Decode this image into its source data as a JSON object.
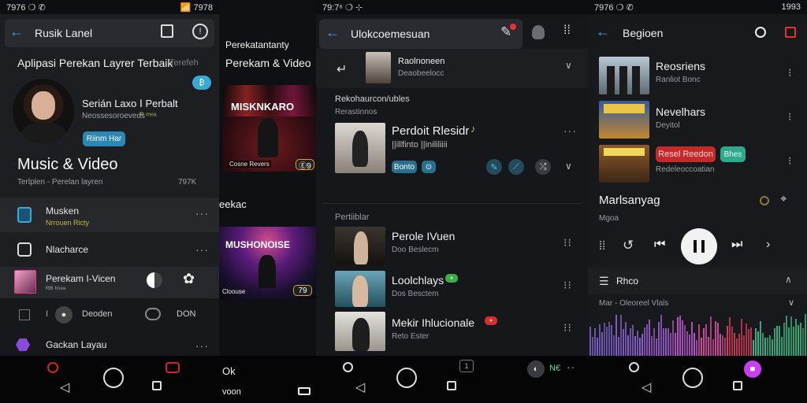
{
  "p1": {
    "status_left": "7976 ❍ ✆",
    "status_right": "📶 7978",
    "header_title": "Rusik Lanel",
    "title": "Aplipasi Perekan Layrer Terbaik",
    "title_tag": "Terefeh",
    "badge": "₿",
    "profile_name": "Serián Laxo Ⅰ Perbalt",
    "profile_sub1": "Neossesoroeveds",
    "profile_sub2": "ᴿ ᵐᵉᵃ",
    "profile_button": "Riinm Har",
    "section_title": "Music & Video",
    "section_sub": "Terlplen - Perelan layren",
    "section_count": "797K",
    "items": [
      {
        "label": "Musken",
        "sub": "Nrrouen Ricty"
      },
      {
        "label": "Nlacharce",
        "sub": ""
      },
      {
        "label": "Perekam I-Vicen",
        "sub": "ᴿᴵᴮ ᴵᵐᵉᵃ"
      },
      {
        "label": "Deoden",
        "sub": "",
        "pre": "I",
        "right": "DON"
      },
      {
        "label": "Gackan Layau",
        "sub": ""
      }
    ]
  },
  "p2": {
    "head1": "Perekatantanty",
    "head2": "Perekam & Video",
    "thumb1_title": "MISKNKARO",
    "thumb1_caption": "Cosne Revers",
    "thumb1_badge": "Ⓔ9",
    "section": "eekac",
    "thumb2_title": "MUSHONOISE",
    "thumb2_caption": "Cloouse",
    "thumb2_badge": "79",
    "nav_label1": "Ok",
    "nav_label2": "voon"
  },
  "p3": {
    "status_left": "79:7⁶ ❍ ⊹",
    "search_text": "Ulokcoemesuan",
    "top_item_title": "Raolnoneen",
    "top_item_sub": "Deaobeelocc",
    "section1": "Rekohaurcon/ubles",
    "section1_sub": "Rerastinnos",
    "card_title": "Perdoit Rlesidr",
    "card_sub": "||illfinto ||inililiiii",
    "card_chip1": "Bonto",
    "card_chip2": "⊙",
    "section2": "Pertiiblar",
    "list": [
      {
        "title": "Perole IVuen",
        "sub": "Doo Beslecm",
        "tag": ""
      },
      {
        "title": "Loolchlays",
        "sub": "Dos Besctem",
        "tag": "●"
      },
      {
        "title": "Mekir Ihlucionale",
        "sub": "Reto Ester",
        "tag": "●"
      }
    ],
    "nav_label": "N€",
    "tab_count": "1"
  },
  "p4": {
    "status_left": "7976 ❍ ✆",
    "status_right": "1993",
    "header_title": "Begioen",
    "list": [
      {
        "title": "Reosriens",
        "sub": "Ranliot Bonc",
        "tag": ""
      },
      {
        "title": "Nevelhars",
        "sub": "Deyitol",
        "tag": ""
      },
      {
        "title": "Resel Reedon",
        "sub": "Redeleoccoatian",
        "tag": "Bhes"
      }
    ],
    "player_title": "Marlsanyag",
    "player_sub": "Mgoa",
    "queue_label": "Rhco",
    "queue_sub": "Mar - Oleoreel Vlals",
    "colors": {
      "accent": "#e6007a"
    }
  },
  "colors": {
    "bg": "#0d0e11",
    "panel": "#17181c",
    "accent_teal": "#35a6d5",
    "accent_pink": "#e8008c",
    "text_dim": "#9a9ba1"
  }
}
